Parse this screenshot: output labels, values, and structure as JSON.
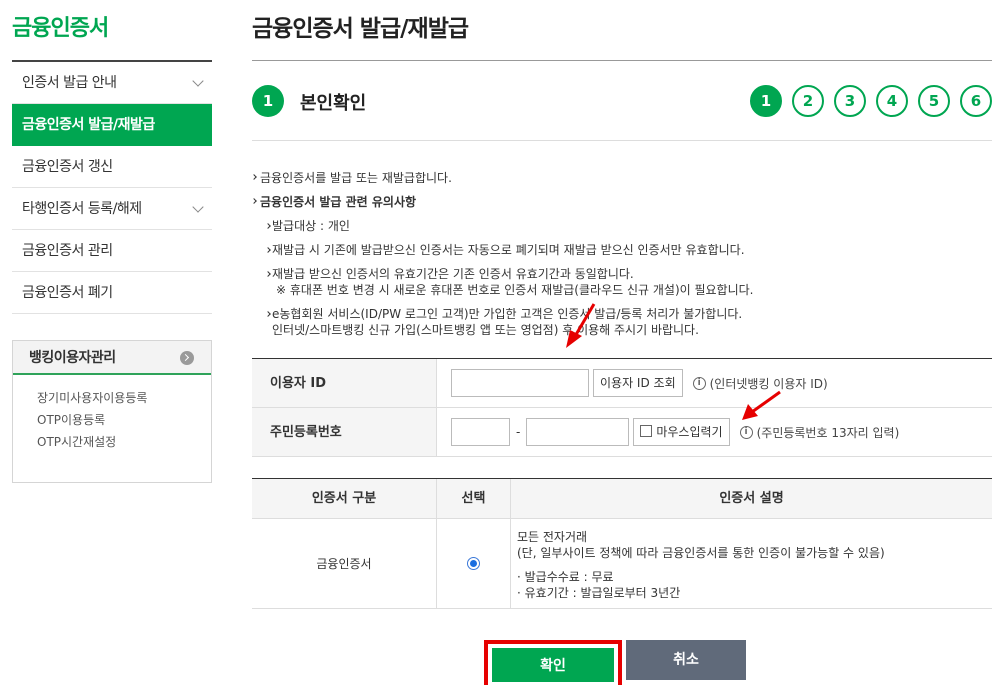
{
  "sidebar": {
    "brand": "금융인증서",
    "items": [
      {
        "label": "인증서 발급 안내"
      },
      {
        "label": "금융인증서 발급/재발급"
      },
      {
        "label": "금융인증서 갱신"
      },
      {
        "label": "타행인증서 등록/해제"
      },
      {
        "label": "금융인증서 관리"
      },
      {
        "label": "금융인증서 폐기"
      }
    ],
    "banking": {
      "title": "뱅킹이용자관리",
      "links": [
        "장기미사용자이용등록",
        "OTP이용등록",
        "OTP시간재설정"
      ]
    }
  },
  "main": {
    "title": "금융인증서 발급/재발급",
    "step": {
      "number": "1",
      "label": "본인확인",
      "dots": [
        "1",
        "2",
        "3",
        "4",
        "5",
        "6"
      ]
    },
    "notice": {
      "intro": "금융인증서를 발급 또는 재발급합니다.",
      "heading": "금융인증서 발급 관련 유의사항",
      "items": [
        "발급대상 : 개인",
        "재발급 시 기존에 발급받으신 인증서는 자동으로 폐기되며 재발급 받으신 인증서만 유효합니다.",
        "재발급 받으신 인증서의 유효기간은 기존 인증서 유효기간과 동일합니다.",
        "※ 휴대폰 번호 변경 시 새로운 휴대폰 번호로 인증서 재발급(클라우드 신규 개설)이 필요합니다.",
        "e농협회원 서비스(ID/PW 로그인 고객)만 가입한 고객은 인증서 발급/등록 처리가 불가합니다.",
        "인터넷/스마트뱅킹 신규 가입(스마트뱅킹 앱 또는 영업점) 후 이용해 주시기 바랍니다."
      ]
    },
    "form": {
      "user_id_label": "이용자 ID",
      "user_id_value": "",
      "lookup_button": "이용자 ID 조회",
      "user_id_hint": "(인터넷뱅킹 이용자 ID)",
      "rrn_label": "주민등록번호",
      "rrn_front_value": "",
      "rrn_dash": "-",
      "rrn_back_value": "",
      "mouse_input_label": "마우스입력기",
      "rrn_hint": "(주민등록번호 13자리 입력)"
    },
    "cert_table": {
      "headers": [
        "인증서 구분",
        "선택",
        "인증서 설명"
      ],
      "rows": [
        {
          "type": "금융인증서",
          "desc": [
            "모든 전자거래",
            "(단, 일부사이트 정책에 따라 금융인증서를 통한 인증이 불가능할 수 있음)",
            "· 발급수수료 : 무료",
            "· 유효기간 : 발급일로부터 3년간"
          ]
        }
      ]
    },
    "actions": {
      "confirm": "확인",
      "cancel": "취소"
    }
  },
  "colors": {
    "accent": "#00a651",
    "highlight": "#e60000",
    "cancel": "#606a7a"
  }
}
